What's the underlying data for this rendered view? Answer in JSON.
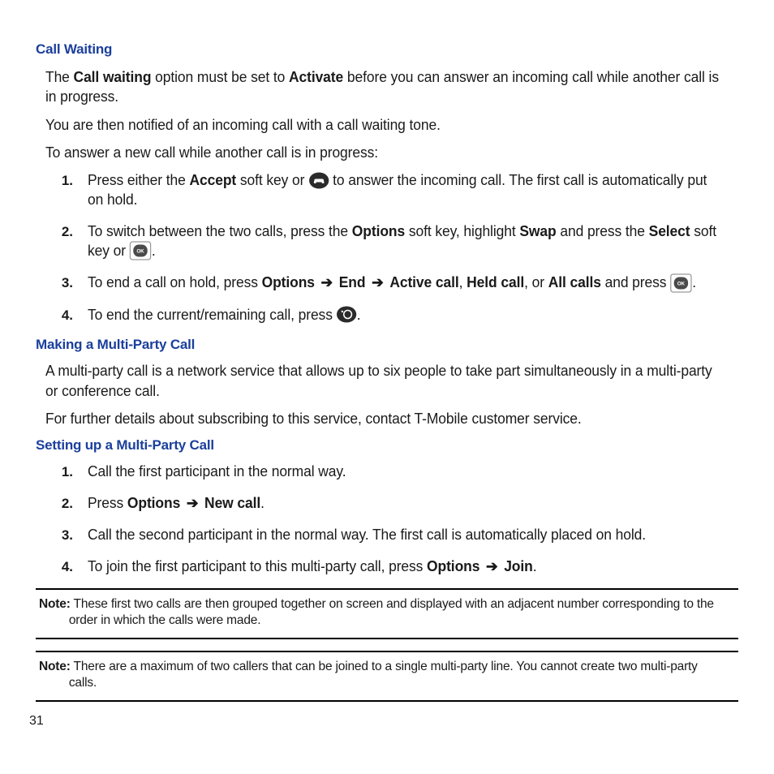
{
  "sections": {
    "call_waiting": {
      "heading": "Call Waiting",
      "p1_pre": "The ",
      "p1_b1": "Call waiting",
      "p1_mid": " option must be set to ",
      "p1_b2": "Activate",
      "p1_post": " before you can answer an incoming call while another call is in progress.",
      "p2": "You are then notified of an incoming call with a call waiting tone.",
      "p3": "To answer a new call while another call is in progress:",
      "steps": {
        "s1": {
          "num": "1.",
          "a": "Press either the ",
          "b1": "Accept",
          "b": " soft key or ",
          "c": " to answer the incoming call. The first call is automatically put on hold."
        },
        "s2": {
          "num": "2.",
          "a": "To switch between the two calls, press the ",
          "b1": "Options",
          "b": " soft key, highlight ",
          "b2": "Swap",
          "c": " and press the ",
          "b3": "Select",
          "d": " soft key or ",
          "e": "."
        },
        "s3": {
          "num": "3.",
          "a": "To end a call on hold, press ",
          "b1": "Options",
          "arrow1": "➔",
          "b2": "End",
          "arrow2": "➔",
          "b3": "Active call",
          "comma1": ", ",
          "b4": "Held call",
          "comma2": ", or ",
          "b5": "All calls",
          "c": " and press ",
          "d": "."
        },
        "s4": {
          "num": "4.",
          "a": "To end the current/remaining call, press ",
          "b": "."
        }
      }
    },
    "multi_party": {
      "heading": "Making a Multi-Party Call",
      "p1": "A multi-party call is a network service that allows up to six people to take part simultaneously in a multi-party or conference call.",
      "p2": "For further details about subscribing to this service, contact T-Mobile customer service."
    },
    "setup": {
      "heading": "Setting up a Multi-Party Call",
      "steps": {
        "s1": {
          "num": "1.",
          "a": "Call the first participant in the normal way."
        },
        "s2": {
          "num": "2.",
          "a": "Press ",
          "b1": "Options",
          "arrow": "➔",
          "b2": "New call",
          "c": "."
        },
        "s3": {
          "num": "3.",
          "a": "Call the second participant in the normal way. The first call is automatically placed on hold."
        },
        "s4": {
          "num": "4.",
          "a": "To join the first participant to this multi-party call, press ",
          "b1": "Options",
          "arrow": "➔",
          "b2": "Join",
          "c": "."
        }
      }
    },
    "notes": {
      "label": "Note:",
      "n1": " These first two calls are then grouped together on screen and displayed with an adjacent number corresponding to the order in which the calls were made.",
      "n2": " There are a maximum of two callers that can be joined to a single multi-party line. You cannot create two multi-party calls."
    }
  },
  "page_number": "31",
  "icons": {
    "call_key": "call-key-icon",
    "ok_key": "ok-key-icon",
    "end_key": "end-key-icon"
  }
}
